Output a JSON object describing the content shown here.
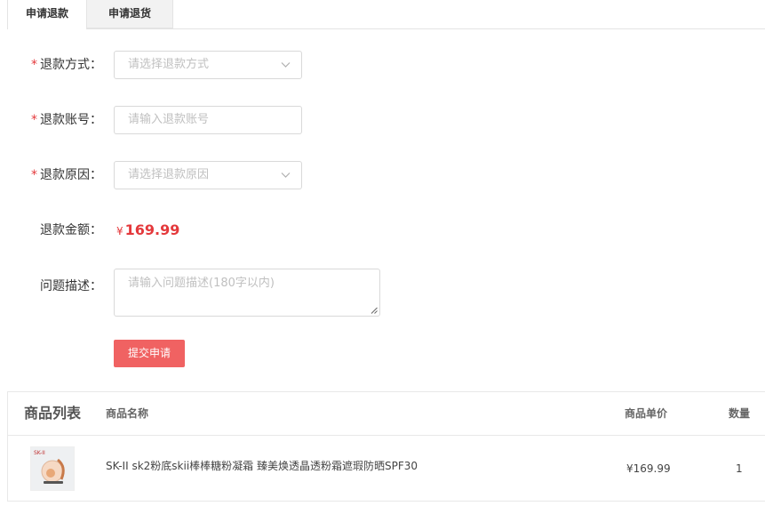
{
  "tabs": [
    {
      "label": "申请退款",
      "active": true
    },
    {
      "label": "申请退货",
      "active": false
    }
  ],
  "form": {
    "required_mark": "*",
    "refund_method": {
      "label": "退款方式：",
      "placeholder": "请选择退款方式"
    },
    "refund_account": {
      "label": "退款账号：",
      "placeholder": "请输入退款账号"
    },
    "refund_reason": {
      "label": "退款原因：",
      "placeholder": "请选择退款原因"
    },
    "refund_amount": {
      "label": "退款金额：",
      "currency": "¥",
      "value": "169.99"
    },
    "description": {
      "label": "问题描述：",
      "placeholder": "请输入问题描述(180字以内)"
    },
    "submit_label": "提交申请"
  },
  "product_list": {
    "title": "商品列表",
    "columns": {
      "name": "商品名称",
      "price": "商品单价",
      "qty": "数量"
    },
    "items": [
      {
        "name": "SK-II sk2粉底skii棒棒糖粉凝霜 臻美焕透晶透粉霜遮瑕防晒SPF30",
        "price": "¥169.99",
        "qty": "1",
        "thumb_label": "SK-II"
      }
    ]
  },
  "colors": {
    "accent_red": "#e4393c",
    "submit_bg": "#f06262",
    "border": "#d9d9d9"
  }
}
